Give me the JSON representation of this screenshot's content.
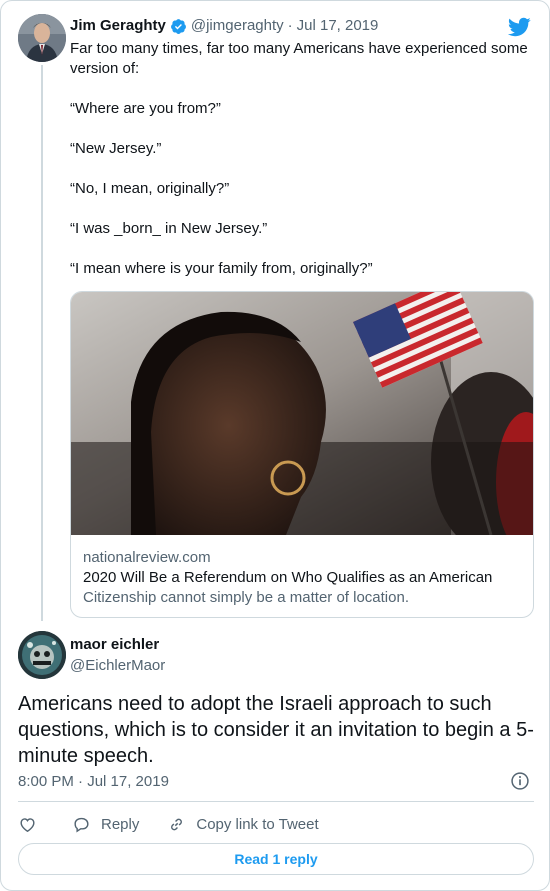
{
  "colors": {
    "brand_blue": "#1d9bf0",
    "text_primary": "#0f1419",
    "text_secondary": "#536471",
    "border": "#cfd9de"
  },
  "parent_tweet": {
    "author_name": "Jim Geraghty",
    "handle": "@jimgeraghty",
    "separator": "·",
    "date": "Jul 17, 2019",
    "verified_icon": "verified-badge-icon",
    "text_lines": [
      "Far too many times, far too many Americans have experienced some version of:",
      "“Where are you from?”",
      "“New Jersey.”",
      "“No, I mean, originally?”",
      "“I was _born_ in New Jersey.”",
      "“I mean where is your family from, originally?”"
    ],
    "link_card": {
      "domain": "nationalreview.com",
      "title": "2020 Will Be a Referendum on Who Qualifies as an American",
      "description": "Citizenship cannot simply be a matter of location."
    }
  },
  "reply_tweet": {
    "author_name": "maor eichler",
    "handle": "@EichlerMaor",
    "text": "Americans need to adopt the Israeli approach to such questions, which is to consider it an invitation to begin a 5-minute speech.",
    "timestamp": "8:00 PM · Jul 17, 2019"
  },
  "actions": {
    "like_icon": "heart-icon",
    "reply_label": "Reply",
    "copy_label": "Copy link to Tweet"
  },
  "read_replies_label": "Read 1 reply"
}
